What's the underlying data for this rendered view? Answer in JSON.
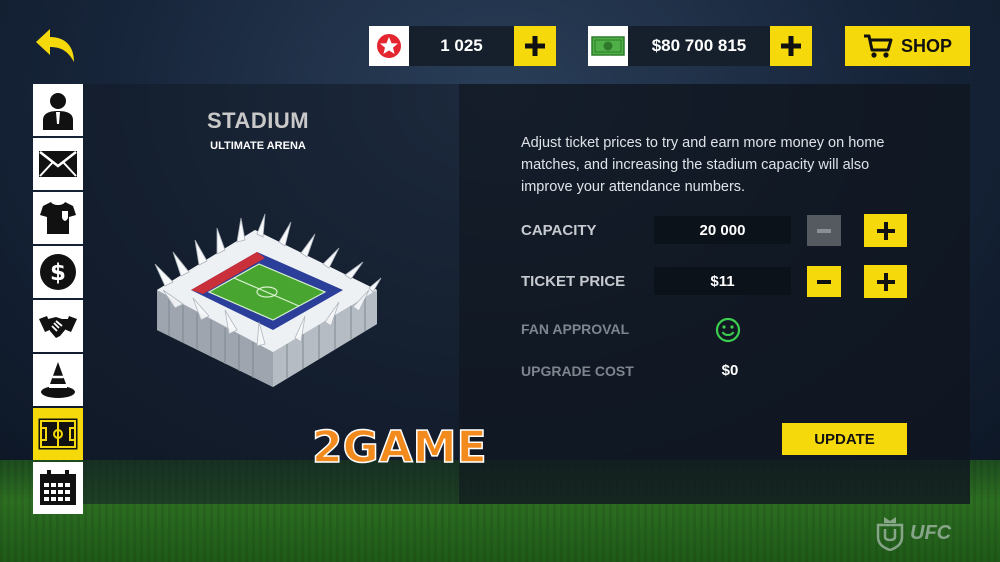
{
  "top_bar": {
    "stars": {
      "icon": "star-badge-icon",
      "value": "1 025"
    },
    "money": {
      "icon": "banknote-icon",
      "value": "$80 700 815"
    },
    "shop_label": "SHOP"
  },
  "side_menu": [
    {
      "icon": "manager-icon",
      "active": false
    },
    {
      "icon": "mail-icon",
      "active": false
    },
    {
      "icon": "jersey-icon",
      "active": false
    },
    {
      "icon": "dollar-icon",
      "active": false
    },
    {
      "icon": "handshake-icon",
      "active": false
    },
    {
      "icon": "training-cone-icon",
      "active": false
    },
    {
      "icon": "stadium-field-icon",
      "active": true
    },
    {
      "icon": "calendar-icon",
      "active": false
    }
  ],
  "stadium": {
    "title": "STADIUM",
    "subtitle": "ULTIMATE ARENA"
  },
  "details": {
    "description": "Adjust ticket prices to try and earn more money on home matches, and increasing the stadium capacity will also improve your attendance numbers.",
    "capacity": {
      "label": "CAPACITY",
      "value": "20 000",
      "minus_enabled": false
    },
    "ticket_price": {
      "label": "TICKET PRICE",
      "value": "$11",
      "minus_enabled": true
    },
    "fan_approval": {
      "label": "FAN APPROVAL",
      "icon": "smiley-face-icon"
    },
    "upgrade_cost": {
      "label": "UPGRADE COST",
      "value": "$0"
    },
    "update_label": "UPDATE"
  },
  "watermark": {
    "text": "2GAME"
  },
  "footer_logo": {
    "text": "UFC"
  },
  "colors": {
    "accent_yellow": "#f5d90a",
    "panel_dark": "#10161f",
    "approval_green": "#3ccf4e"
  }
}
